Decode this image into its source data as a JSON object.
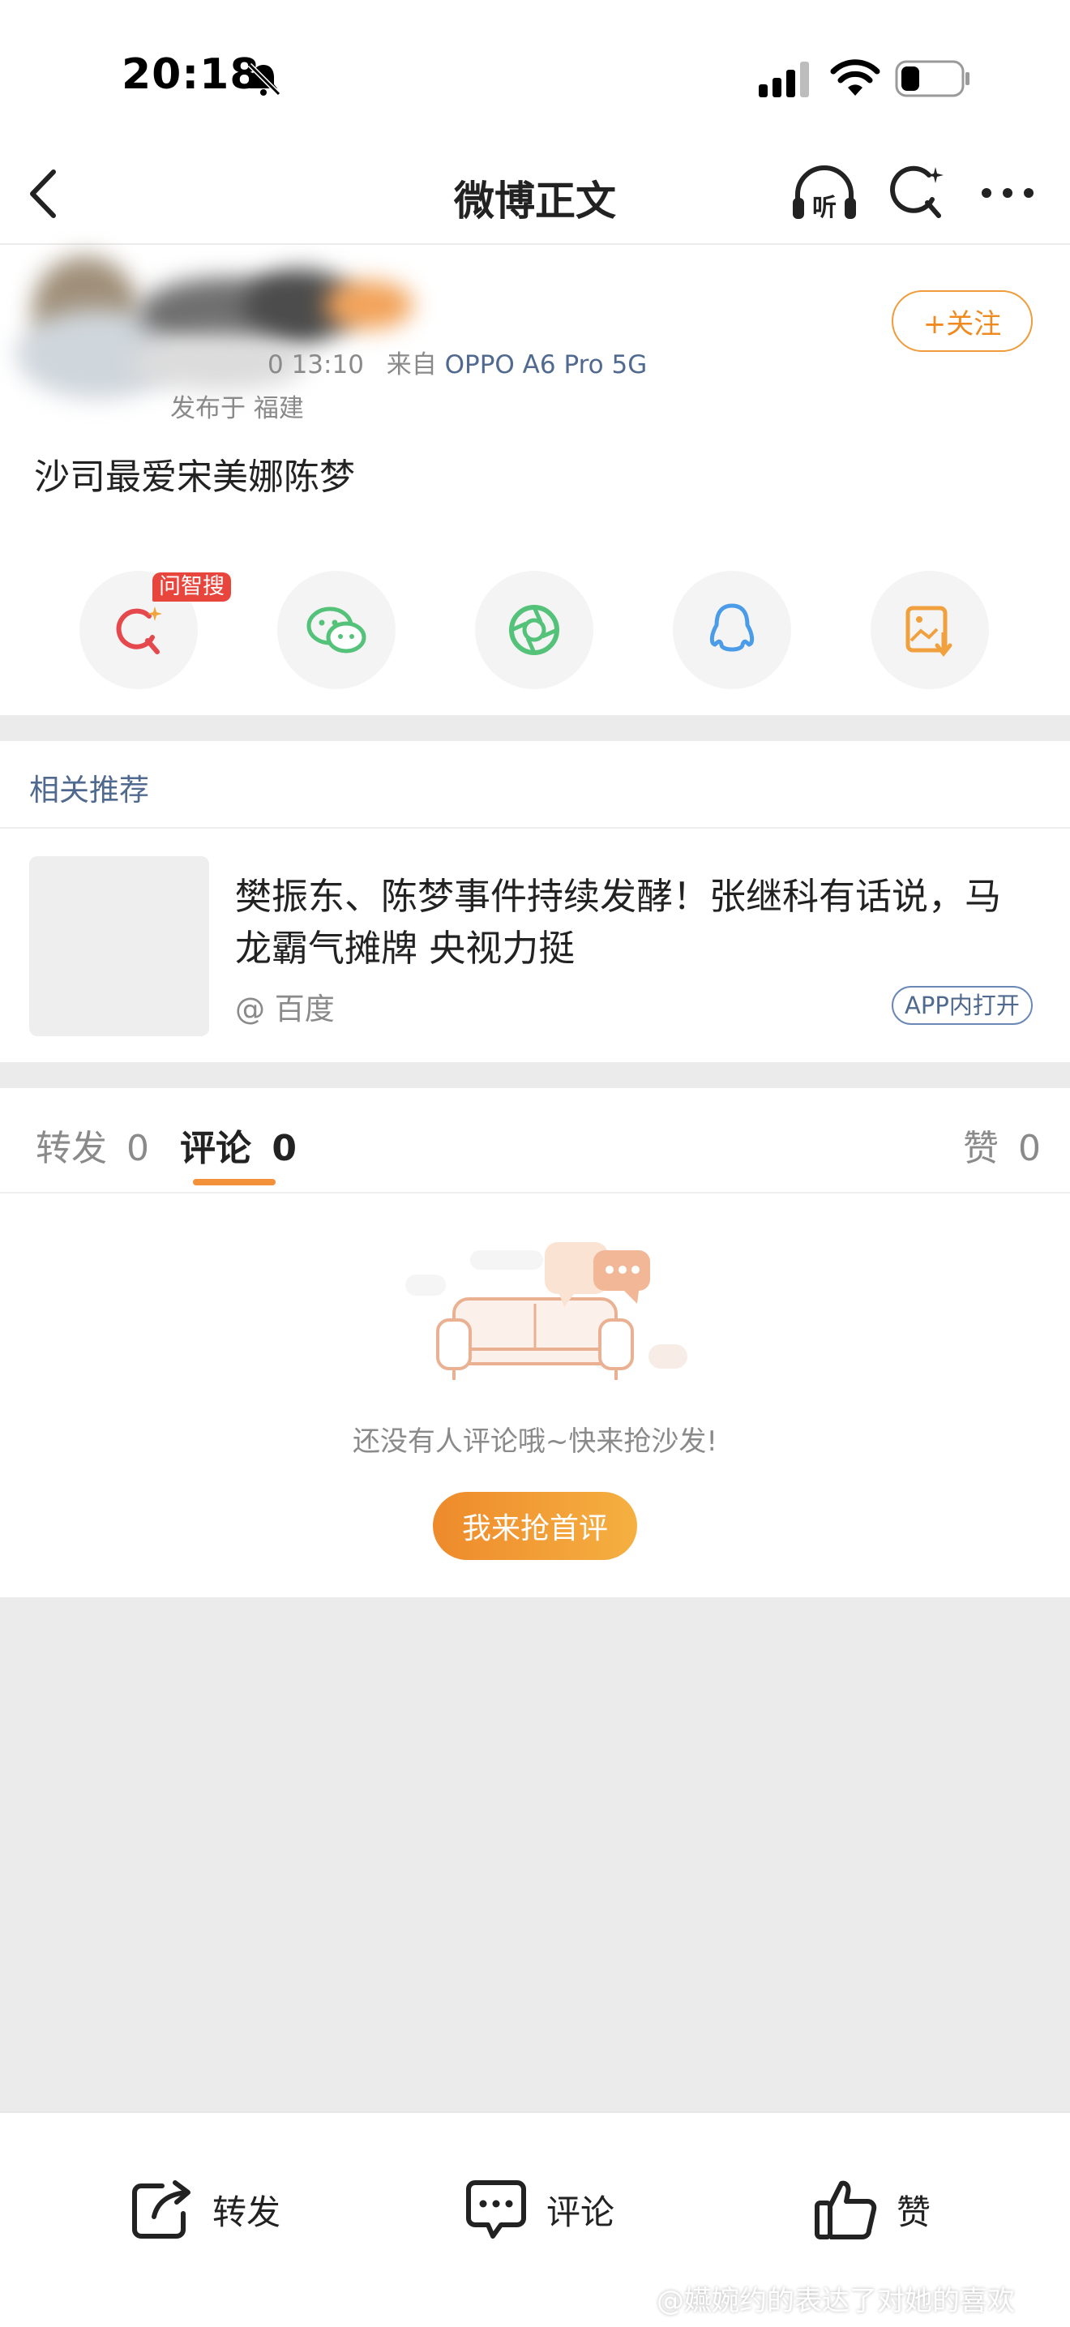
{
  "status_bar": {
    "time": "20:18"
  },
  "nav": {
    "title": "微博正文"
  },
  "post": {
    "follow_label": "+关注",
    "time_partial": "0 13:10",
    "source_prefix": "来自",
    "source_device": "OPPO A6 Pro 5G",
    "location": "发布于 福建",
    "text": "沙司最爱宋美娜陈梦",
    "ai_badge": "问智搜"
  },
  "related": {
    "heading": "相关推荐",
    "title": "樊振东、陈梦事件持续发酵！张继科有话说，马龙霸气摊牌 央视力挺",
    "source": "@ 百度",
    "open_label": "APP内打开"
  },
  "comments": {
    "tabs": [
      {
        "label": "转发",
        "count": "0"
      },
      {
        "label": "评论",
        "count": "0"
      },
      {
        "label": "赞",
        "count": "0"
      }
    ],
    "empty_text": "还没有人评论哦~快来抢沙发!",
    "first_button": "我来抢首评"
  },
  "bottom_bar": {
    "repost": "转发",
    "comment": "评论",
    "like": "赞"
  },
  "watermark": "@嬿婉约的表达了对她的喜欢",
  "colors": {
    "accent": "#f2913a",
    "link": "#50698f",
    "badge": "#e8463d"
  }
}
